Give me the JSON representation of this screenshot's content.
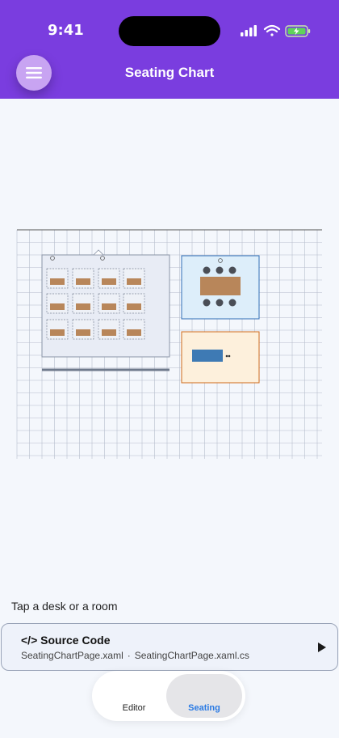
{
  "status": {
    "time": "9:41"
  },
  "header": {
    "title": "Seating Chart",
    "menu_icon": "hamburger-menu-icon"
  },
  "colors": {
    "header_bg": "#7a3ddf",
    "menu_button": "#c8a4f2",
    "classroom_bg": "#e8ecf5",
    "meeting_room_bg": "#ddeefa",
    "meeting_room_border": "#2f6fb6",
    "office_bg": "#fdf0dc",
    "office_border": "#cf6a1a",
    "desk_fill": "#b8865a",
    "office_desk_fill": "#3e7ab4",
    "chair_fill": "#4a4e56",
    "selected_tab_text": "#2b7be4"
  },
  "hint": "Tap a desk or a room",
  "source": {
    "title": "</> Source Code",
    "file1": "SeatingChartPage.xaml",
    "separator": "·",
    "file2": "SeatingChartPage.xaml.cs"
  },
  "tabs": {
    "editor": "Editor",
    "seating": "Seating",
    "selected": "seating"
  }
}
